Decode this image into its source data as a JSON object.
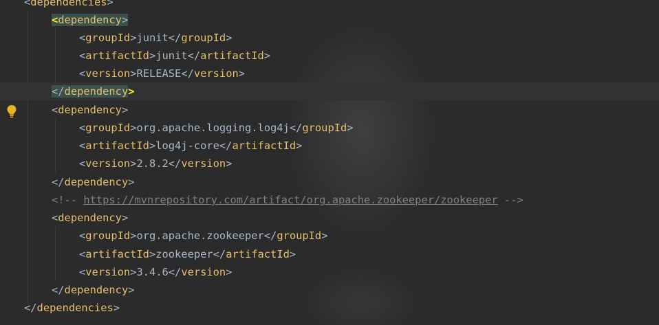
{
  "code": {
    "deps_open_tag": "dependencies",
    "dependency_tag": "dependency",
    "group_tag": "groupId",
    "artifact_tag": "artifactId",
    "version_tag": "version",
    "deps_close_tag": "dependencies",
    "dep1": {
      "group": "junit",
      "artifact": "junit",
      "version": "RELEASE"
    },
    "dep2": {
      "group": "org.apache.logging.log4j",
      "artifact": "log4j-core",
      "version": "2.8.2"
    },
    "comment": {
      "open": "<!-- ",
      "url": "https://mvnrepository.com/artifact/org.apache.zookeeper/zookeeper",
      "close": " -->"
    },
    "dep3": {
      "group": "org.apache.zookeeper",
      "artifact": "zookeeper",
      "version": "3.4.6"
    }
  },
  "gutter": {
    "bulb_icon": "lightbulb-icon",
    "bulb_color": "#e6b422"
  }
}
